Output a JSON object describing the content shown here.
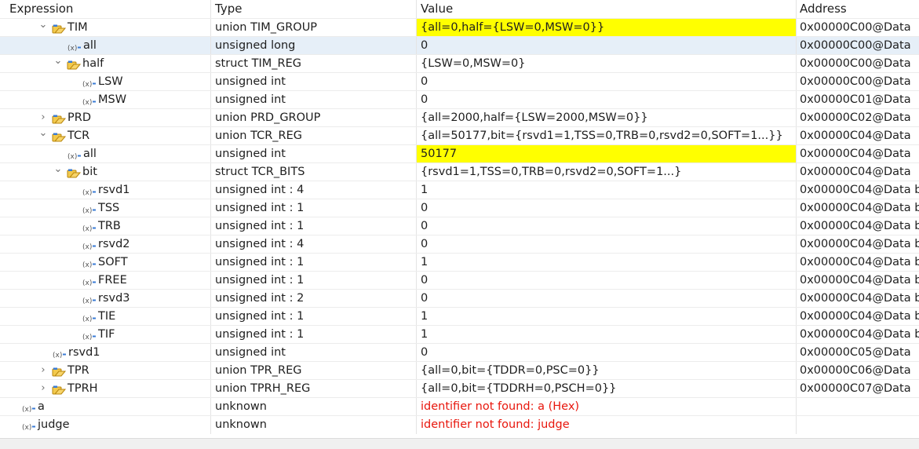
{
  "header": {
    "expression": "Expression",
    "type": "Type",
    "value": "Value",
    "address": "Address"
  },
  "rows": [
    {
      "depth": 1,
      "tw": "open",
      "icon": "struct",
      "name": "TIM",
      "type": "union TIM_GROUP",
      "value": "{all=0,half={LSW=0,MSW=0}}",
      "addr": "0x00000C00@Data",
      "hl": true
    },
    {
      "depth": 2,
      "tw": "none",
      "icon": "var",
      "name": "all",
      "type": "unsigned long",
      "value": "0",
      "addr": "0x00000C00@Data",
      "sel": true
    },
    {
      "depth": 2,
      "tw": "open",
      "icon": "struct",
      "name": "half",
      "type": "struct TIM_REG",
      "value": "{LSW=0,MSW=0}",
      "addr": "0x00000C00@Data"
    },
    {
      "depth": 3,
      "tw": "none",
      "icon": "var",
      "name": "LSW",
      "type": "unsigned int",
      "value": "0",
      "addr": "0x00000C00@Data"
    },
    {
      "depth": 3,
      "tw": "none",
      "icon": "var",
      "name": "MSW",
      "type": "unsigned int",
      "value": "0",
      "addr": "0x00000C01@Data"
    },
    {
      "depth": 1,
      "tw": "closed",
      "icon": "struct",
      "name": "PRD",
      "type": "union PRD_GROUP",
      "value": "{all=2000,half={LSW=2000,MSW=0}}",
      "addr": "0x00000C02@Data"
    },
    {
      "depth": 1,
      "tw": "open",
      "icon": "struct",
      "name": "TCR",
      "type": "union TCR_REG",
      "value": "{all=50177,bit={rsvd1=1,TSS=0,TRB=0,rsvd2=0,SOFT=1...}}",
      "addr": "0x00000C04@Data"
    },
    {
      "depth": 2,
      "tw": "none",
      "icon": "var",
      "name": "all",
      "type": "unsigned int",
      "value": "50177",
      "addr": "0x00000C04@Data",
      "hl": true
    },
    {
      "depth": 2,
      "tw": "open",
      "icon": "struct",
      "name": "bit",
      "type": "struct TCR_BITS",
      "value": "{rsvd1=1,TSS=0,TRB=0,rsvd2=0,SOFT=1...}",
      "addr": "0x00000C04@Data"
    },
    {
      "depth": 3,
      "tw": "none",
      "icon": "var",
      "name": "rsvd1",
      "type": "unsigned int : 4",
      "value": "1",
      "addr": "0x00000C04@Data b"
    },
    {
      "depth": 3,
      "tw": "none",
      "icon": "var",
      "name": "TSS",
      "type": "unsigned int : 1",
      "value": "0",
      "addr": "0x00000C04@Data b"
    },
    {
      "depth": 3,
      "tw": "none",
      "icon": "var",
      "name": "TRB",
      "type": "unsigned int : 1",
      "value": "0",
      "addr": "0x00000C04@Data b"
    },
    {
      "depth": 3,
      "tw": "none",
      "icon": "var",
      "name": "rsvd2",
      "type": "unsigned int : 4",
      "value": "0",
      "addr": "0x00000C04@Data b"
    },
    {
      "depth": 3,
      "tw": "none",
      "icon": "var",
      "name": "SOFT",
      "type": "unsigned int : 1",
      "value": "1",
      "addr": "0x00000C04@Data b"
    },
    {
      "depth": 3,
      "tw": "none",
      "icon": "var",
      "name": "FREE",
      "type": "unsigned int : 1",
      "value": "0",
      "addr": "0x00000C04@Data b"
    },
    {
      "depth": 3,
      "tw": "none",
      "icon": "var",
      "name": "rsvd3",
      "type": "unsigned int : 2",
      "value": "0",
      "addr": "0x00000C04@Data b"
    },
    {
      "depth": 3,
      "tw": "none",
      "icon": "var",
      "name": "TIE",
      "type": "unsigned int : 1",
      "value": "1",
      "addr": "0x00000C04@Data b"
    },
    {
      "depth": 3,
      "tw": "none",
      "icon": "var",
      "name": "TIF",
      "type": "unsigned int : 1",
      "value": "1",
      "addr": "0x00000C04@Data b"
    },
    {
      "depth": 1,
      "tw": "none",
      "icon": "var",
      "name": "rsvd1",
      "type": "unsigned int",
      "value": "0",
      "addr": "0x00000C05@Data"
    },
    {
      "depth": 1,
      "tw": "closed",
      "icon": "struct",
      "name": "TPR",
      "type": "union TPR_REG",
      "value": "{all=0,bit={TDDR=0,PSC=0}}",
      "addr": "0x00000C06@Data"
    },
    {
      "depth": 1,
      "tw": "closed",
      "icon": "struct",
      "name": "TPRH",
      "type": "union TPRH_REG",
      "value": "{all=0,bit={TDDRH=0,PSCH=0}}",
      "addr": "0x00000C07@Data"
    },
    {
      "depth": 0,
      "tw": "none",
      "icon": "var",
      "name": "a",
      "type": "unknown",
      "value": "identifier not found: a (Hex)",
      "addr": "",
      "err": true
    },
    {
      "depth": 0,
      "tw": "none",
      "icon": "var",
      "name": "judge",
      "type": "unknown",
      "value": "identifier not found: judge",
      "addr": "",
      "err": true
    }
  ],
  "colors": {
    "highlight": "#ffff00",
    "error": "#e8160c",
    "selection": "#e6eff8"
  }
}
